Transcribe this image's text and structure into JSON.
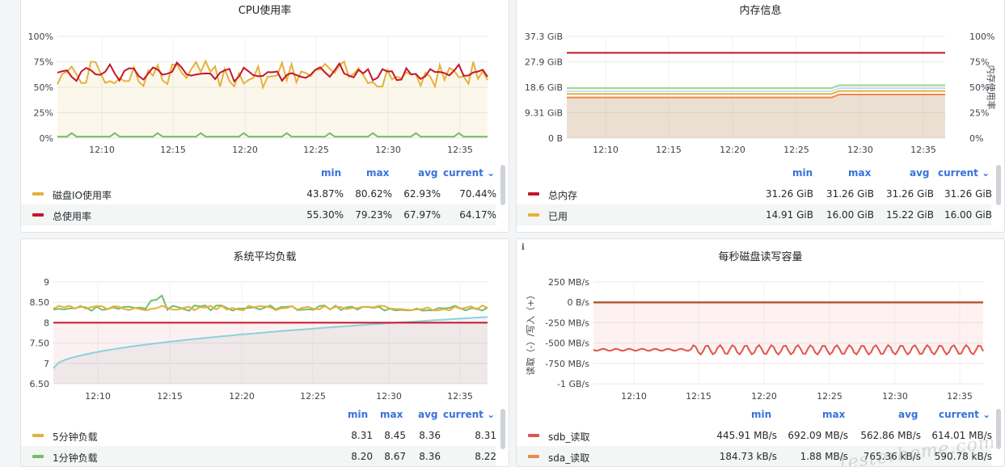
{
  "panels": [
    {
      "title": "CPU使用率",
      "legend": {
        "headers": {
          "min": "min",
          "max": "max",
          "avg": "avg",
          "current": "current ⌄"
        },
        "rows": [
          {
            "name": "磁盘IO使用率",
            "color": "#e5b13d",
            "min": "43.87%",
            "max": "80.62%",
            "avg": "62.93%",
            "current": "70.44%"
          },
          {
            "name": "总使用率",
            "color": "#c4162a",
            "min": "55.30%",
            "max": "79.23%",
            "avg": "67.97%",
            "current": "64.17%"
          }
        ]
      }
    },
    {
      "title": "内存信息",
      "legend": {
        "headers": {
          "min": "min",
          "max": "max",
          "avg": "avg",
          "current": "current ⌄"
        },
        "rows": [
          {
            "name": "总内存",
            "color": "#c4162a",
            "min": "31.26 GiB",
            "max": "31.26 GiB",
            "avg": "31.26 GiB",
            "current": "31.26 GiB"
          },
          {
            "name": "已用",
            "color": "#e5b13d",
            "min": "14.91 GiB",
            "max": "16.00 GiB",
            "avg": "15.22 GiB",
            "current": "16.00 GiB"
          }
        ]
      }
    },
    {
      "title": "系统平均负载",
      "legend": {
        "headers": {
          "min": "min",
          "max": "max",
          "avg": "avg",
          "current": "current ⌄"
        },
        "rows": [
          {
            "name": "5分钟负载",
            "color": "#e5b13d",
            "min": "8.31",
            "max": "8.45",
            "avg": "8.36",
            "current": "8.31"
          },
          {
            "name": "1分钟负载",
            "color": "#73bf69",
            "min": "8.20",
            "max": "8.67",
            "avg": "8.36",
            "current": "8.22"
          }
        ]
      }
    },
    {
      "title": "每秒磁盘读写容量",
      "info_icon": "i",
      "legend": {
        "headers": {
          "min": "min",
          "max": "max",
          "avg": "avg",
          "current": "current ⌄"
        },
        "rows": [
          {
            "name": "sdb_读取",
            "color": "#e0554d",
            "min": "445.91 MB/s",
            "max": "692.09 MB/s",
            "avg": "562.86 MB/s",
            "current": "614.01 MB/s"
          },
          {
            "name": "sda_读取",
            "color": "#f2884d",
            "min": "184.73 kB/s",
            "max": "1.88 MB/s",
            "avg": "765.36 kB/s",
            "current": "590.78 kB/s"
          }
        ]
      }
    }
  ],
  "chart_data": [
    {
      "type": "line",
      "title": "CPU使用率",
      "x": [
        "12:10",
        "12:15",
        "12:20",
        "12:25",
        "12:30",
        "12:35"
      ],
      "yticks": [
        "100%",
        "75%",
        "50%",
        "25%",
        "0%"
      ],
      "ylim": [
        0,
        100
      ],
      "series": [
        {
          "name": "总使用率",
          "color": "#c4162a",
          "min": 55.3,
          "max": 79.23,
          "avg": 67.97,
          "current": 64.17
        },
        {
          "name": "磁盘IO使用率",
          "color": "#e5b13d",
          "min": 43.87,
          "max": 80.62,
          "avg": 62.93,
          "current": 70.44
        },
        {
          "color": "#73bf69",
          "approx_level": 1.5
        }
      ]
    },
    {
      "type": "line",
      "title": "内存信息",
      "x": [
        "12:10",
        "12:15",
        "12:20",
        "12:25",
        "12:30",
        "12:35"
      ],
      "yticks_left": [
        "37.3 GiB",
        "27.9 GiB",
        "18.6 GiB",
        "9.31 GiB",
        "0 B"
      ],
      "yticks_right": [
        "100%",
        "75%",
        "50%",
        "25%",
        "0%"
      ],
      "ylabel_right": "内存使用率",
      "series": [
        {
          "name": "总内存",
          "color": "#c4162a",
          "value_gib": 31.26
        },
        {
          "name": "已用",
          "color": "#e5b13d",
          "min": 14.91,
          "max": 16.0,
          "avg": 15.22,
          "current": 16.0
        }
      ]
    },
    {
      "type": "line",
      "title": "系统平均负载",
      "x": [
        "12:10",
        "12:15",
        "12:20",
        "12:25",
        "12:30",
        "12:35"
      ],
      "yticks": [
        "9",
        "8.50",
        "8",
        "7.50",
        "7",
        "6.50"
      ],
      "ylim": [
        6.5,
        9
      ],
      "series": [
        {
          "name": "5分钟负载",
          "color": "#e5b13d",
          "min": 8.31,
          "max": 8.45,
          "avg": 8.36,
          "current": 8.31
        },
        {
          "name": "1分钟负载",
          "color": "#73bf69",
          "min": 8.2,
          "max": 8.67,
          "avg": 8.36,
          "current": 8.22
        },
        {
          "color": "#c4162a",
          "value": 8.0
        },
        {
          "color": "#8ad2dc",
          "start": 6.88,
          "end": 8.14
        }
      ]
    },
    {
      "type": "line",
      "title": "每秒磁盘读写容量",
      "x": [
        "12:10",
        "12:15",
        "12:20",
        "12:25",
        "12:30",
        "12:35"
      ],
      "yticks": [
        "250 MB/s",
        "0 B/s",
        "-250 MB/s",
        "-500 MB/s",
        "-750 MB/s",
        "-1 GB/s"
      ],
      "ylabel": "读取（-）/写入（+）",
      "ylim": [
        -1000,
        250
      ],
      "series": [
        {
          "name": "sdb_读取",
          "color": "#e0554d",
          "min": 445.91,
          "max": 692.09,
          "avg": 562.86,
          "current": 614.01
        },
        {
          "name": "sda_读取",
          "color": "#f2884d",
          "value": 0
        }
      ]
    }
  ],
  "watermark": "testerhome.com"
}
